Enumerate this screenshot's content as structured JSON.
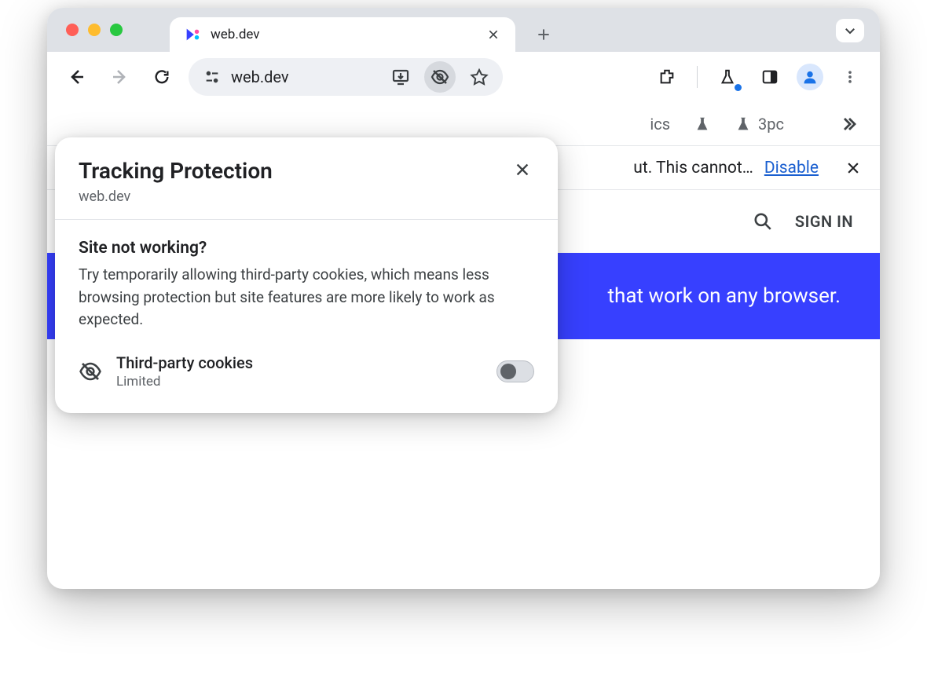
{
  "tab": {
    "title": "web.dev"
  },
  "omnibox": {
    "url": "web.dev"
  },
  "bookmarks": {
    "frag": "ics",
    "item_3pc": "3pc"
  },
  "infobar": {
    "text_fragment": "ut. This cannot…",
    "link": "Disable"
  },
  "page": {
    "signin": "SIGN IN",
    "banner_fragment": "that work on any browser."
  },
  "popover": {
    "title": "Tracking Protection",
    "site": "web.dev",
    "question": "Site not working?",
    "description": "Try temporarily allowing third-party cookies, which means less browsing protection but site features are more likely to work as expected.",
    "cookies_label": "Third-party cookies",
    "cookies_status": "Limited"
  }
}
